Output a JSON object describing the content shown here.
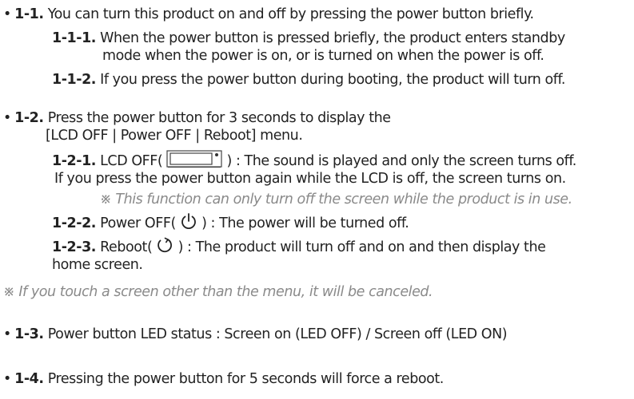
{
  "items": {
    "i1_1": {
      "bullet": "•",
      "num": "1-1.",
      "text": " You can turn this product on and off by pressing the power button briefly."
    },
    "i1_1_1": {
      "num": "1-1-1.",
      "text1": " When the power button is pressed briefly, the product enters standby",
      "text2": "mode when the power is on, or is turned on when the power is off."
    },
    "i1_1_2": {
      "num": "1-1-2.",
      "text": " If you press the power button during booting, the product will turn off."
    },
    "i1_2": {
      "bullet": "•",
      "num": "1-2.",
      "text1": " Press the power button for 3 seconds to display the",
      "text2": "[LCD OFF | Power OFF | Reboot] menu."
    },
    "i1_2_1": {
      "num": "1-2-1.",
      "text_before": " LCD OFF( ",
      "text_after": " ) : The sound is played and only the screen turns off.",
      "text2": "If you press the power button again while the LCD is off, the screen turns on.",
      "note": "※ This function can only turn off the screen while the product is in use."
    },
    "i1_2_2": {
      "num": "1-2-2.",
      "text_before": " Power OFF( ",
      "text_after": " ) : The power will be turned off."
    },
    "i1_2_3": {
      "num": "1-2-3.",
      "text_before": " Reboot( ",
      "text_after": " ) : The product will turn off and on and then display the",
      "text2": "home screen."
    },
    "menu_note": "※ If you touch a screen other than the menu, it will be canceled.",
    "i1_3": {
      "bullet": "•",
      "num": "1-3.",
      "text": " Power button LED status : Screen on (LED OFF) / Screen off (LED ON)"
    },
    "i1_4": {
      "bullet": "•",
      "num": "1-4.",
      "text": " Pressing the power button for 5 seconds will force a reboot."
    }
  },
  "icons": {
    "lcd": "lcd-screen-icon",
    "power": "power-icon",
    "reboot": "reboot-icon"
  },
  "colors": {
    "text": "#222222",
    "note": "#8a8a8a"
  }
}
